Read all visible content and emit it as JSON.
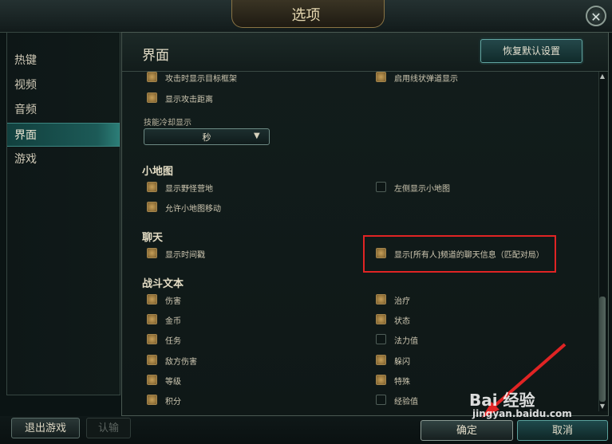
{
  "window": {
    "title": "选项",
    "close_icon": "close-icon"
  },
  "sidebar": {
    "items": [
      {
        "label": "热键",
        "active": false
      },
      {
        "label": "视频",
        "active": false
      },
      {
        "label": "音频",
        "active": false
      },
      {
        "label": "界面",
        "active": true
      },
      {
        "label": "游戏",
        "active": false
      }
    ]
  },
  "main": {
    "title": "界面",
    "reset_label": "恢复默认设置",
    "options_top": [
      {
        "label": "攻击时显示目标框架",
        "checked": true
      },
      {
        "label": "启用线状弹道显示",
        "checked": true
      },
      {
        "label": "显示攻击距离",
        "checked": true
      }
    ],
    "cooldown": {
      "label": "技能冷却显示",
      "value": "秒"
    },
    "minimap": {
      "title": "小地图",
      "options": [
        {
          "label": "显示野怪营地",
          "checked": true
        },
        {
          "label": "左侧显示小地图",
          "checked": false
        },
        {
          "label": "允许小地图移动",
          "checked": true
        }
      ]
    },
    "chat": {
      "title": "聊天",
      "options": [
        {
          "label": "显示时间戳",
          "checked": true
        },
        {
          "label": "显示[所有人]频道的聊天信息（匹配对局）",
          "checked": true
        }
      ]
    },
    "combat_text": {
      "title": "战斗文本",
      "options": [
        {
          "label": "伤害",
          "checked": true
        },
        {
          "label": "治疗",
          "checked": true
        },
        {
          "label": "金币",
          "checked": true
        },
        {
          "label": "状态",
          "checked": true
        },
        {
          "label": "任务",
          "checked": true
        },
        {
          "label": "法力值",
          "checked": false
        },
        {
          "label": "敌方伤害",
          "checked": true
        },
        {
          "label": "躲闪",
          "checked": true
        },
        {
          "label": "等级",
          "checked": true
        },
        {
          "label": "特殊",
          "checked": true
        },
        {
          "label": "积分",
          "checked": true
        },
        {
          "label": "经验值",
          "checked": false
        }
      ]
    }
  },
  "footer": {
    "exit_label": "退出游戏",
    "surrender_label": "认输",
    "ok_label": "确定",
    "cancel_label": "取消"
  },
  "watermark": {
    "brand": "Bai 经验",
    "url": "jingyan.baidu.com"
  },
  "colors": {
    "accent": "#2c7e78",
    "checkbox_on": "#c59e58",
    "highlight": "#e02424"
  }
}
